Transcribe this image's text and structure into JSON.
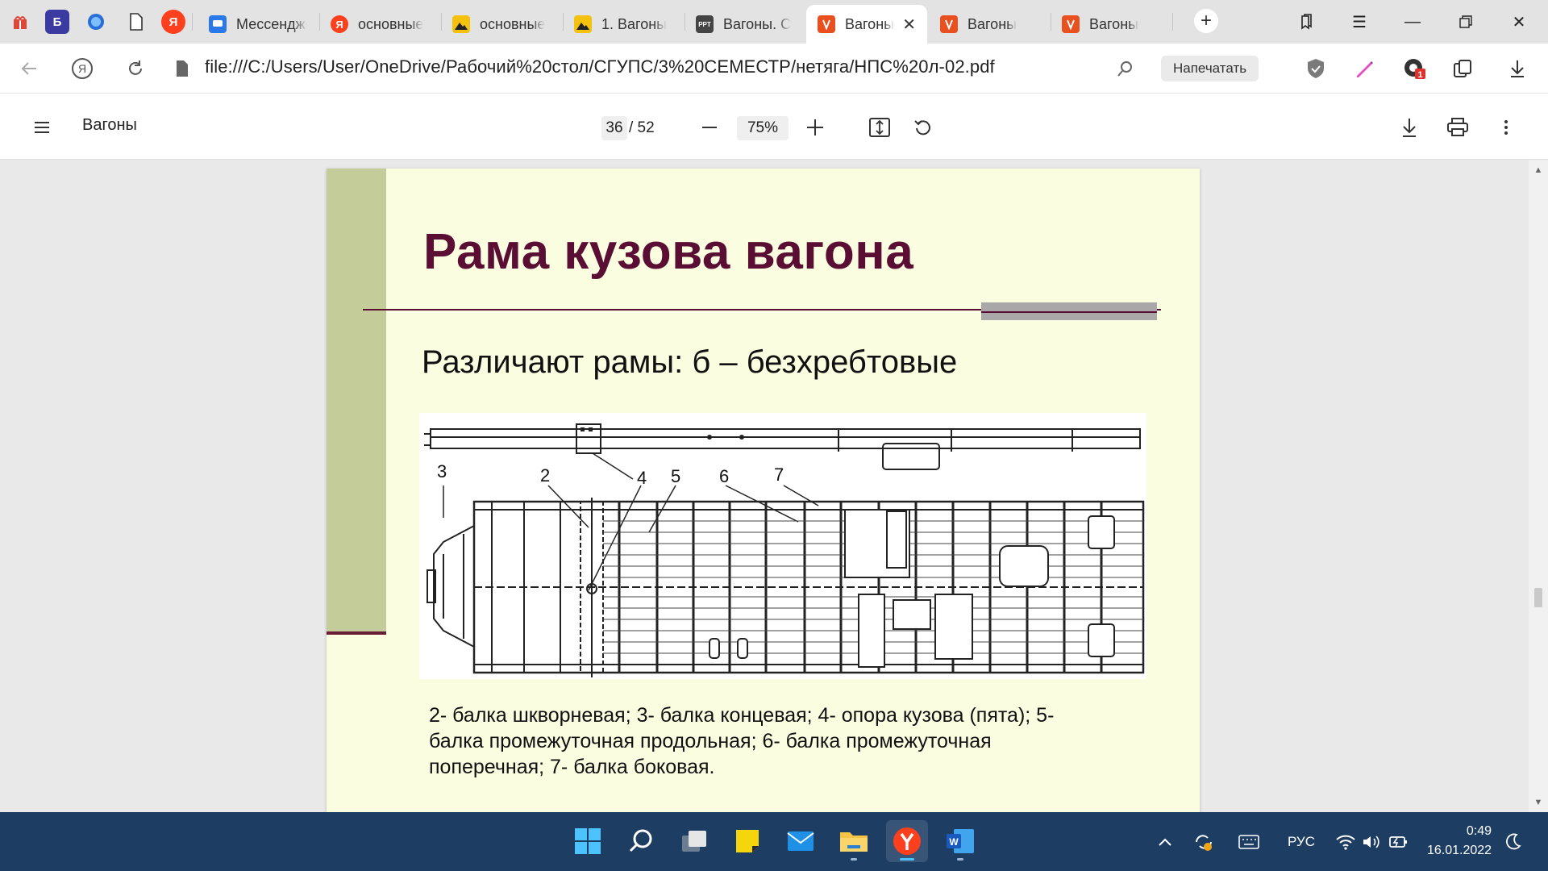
{
  "browser": {
    "pinned": [
      "Б",
      "Я"
    ],
    "tabs": [
      {
        "label": "Мессенджер",
        "icon": "messenger-icon"
      },
      {
        "label": "основные",
        "icon": "yandex-icon"
      },
      {
        "label": "основные",
        "icon": "image-icon"
      },
      {
        "label": "1. Вагоны",
        "icon": "image-icon"
      },
      {
        "label": "Вагоны. С",
        "icon": "ppt-icon"
      },
      {
        "label": "Вагоны",
        "icon": "pdf-icon",
        "active": true
      },
      {
        "label": "Вагоны",
        "icon": "pdf-icon"
      },
      {
        "label": "Вагоны",
        "icon": "pdf-icon"
      }
    ],
    "url": "file:///C:/Users/User/OneDrive/Рабочий%20стол/СГУПС/3%20СЕМЕСТР/нетяга/НПС%20л-02.pdf",
    "print_label": "Напечатать",
    "notif_count": "1"
  },
  "pdf": {
    "title": "Вагоны",
    "page": "36",
    "total": "/ 52",
    "zoom": "75%"
  },
  "slide": {
    "title": "Рама кузова вагона",
    "subtitle": "Различают рамы: б – безхребтовые",
    "labels": [
      "3",
      "2",
      "4",
      "5",
      "6",
      "7"
    ],
    "caption": "2- балка шкворневая; 3- балка концевая; 4- опора кузова (пята); 5- балка промежуточная продольная; 6- балка промежуточная поперечная; 7- балка боковая."
  },
  "taskbar": {
    "lang": "РУС",
    "time": "0:49",
    "date": "16.01.2022"
  },
  "colors": {
    "slide_bg": "#fbfde0",
    "slide_left": "#c4cc99",
    "title_color": "#5a0e33",
    "taskbar": "#1d3d63"
  }
}
